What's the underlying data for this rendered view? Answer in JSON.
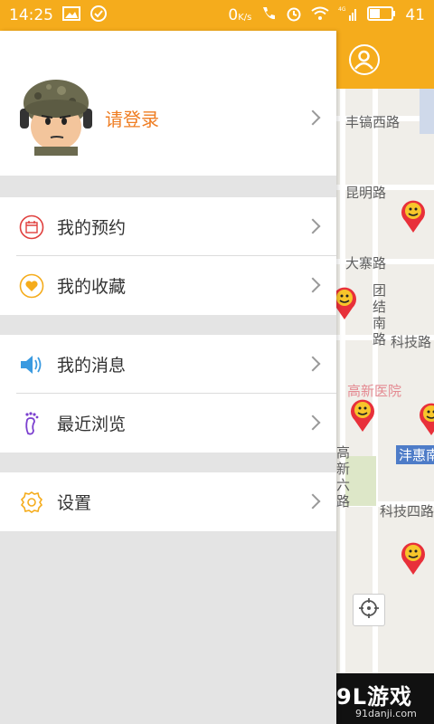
{
  "status_bar": {
    "time": "14:25",
    "network_speed": "0",
    "signal_label": "4G",
    "battery_level": "41"
  },
  "drawer": {
    "login_label": "请登录",
    "groups": [
      {
        "items": [
          {
            "label": "我的预约",
            "icon": "calendar-icon"
          },
          {
            "label": "我的收藏",
            "icon": "heart-icon"
          }
        ]
      },
      {
        "items": [
          {
            "label": "我的消息",
            "icon": "speaker-icon"
          },
          {
            "label": "最近浏览",
            "icon": "footprint-icon"
          }
        ]
      },
      {
        "items": [
          {
            "label": "设置",
            "icon": "gear-icon"
          }
        ]
      }
    ]
  },
  "map": {
    "roads": {
      "fenghao": "丰镐西路",
      "kunming": "昆明路",
      "dazhai": "大寨路",
      "tuanjie_nan": "团结南路",
      "keji": "科技路",
      "gaoxin_liu": "高新六路",
      "keji_si": "科技四路",
      "fenghui": "沣惠南"
    },
    "hospital": "高新医院"
  },
  "watermark": {
    "main": "9L游戏",
    "sub": "91danji.com"
  },
  "colors": {
    "accent": "#f5ac1c",
    "login_orange": "#ef7d22",
    "map_bg": "#f0eee9"
  }
}
